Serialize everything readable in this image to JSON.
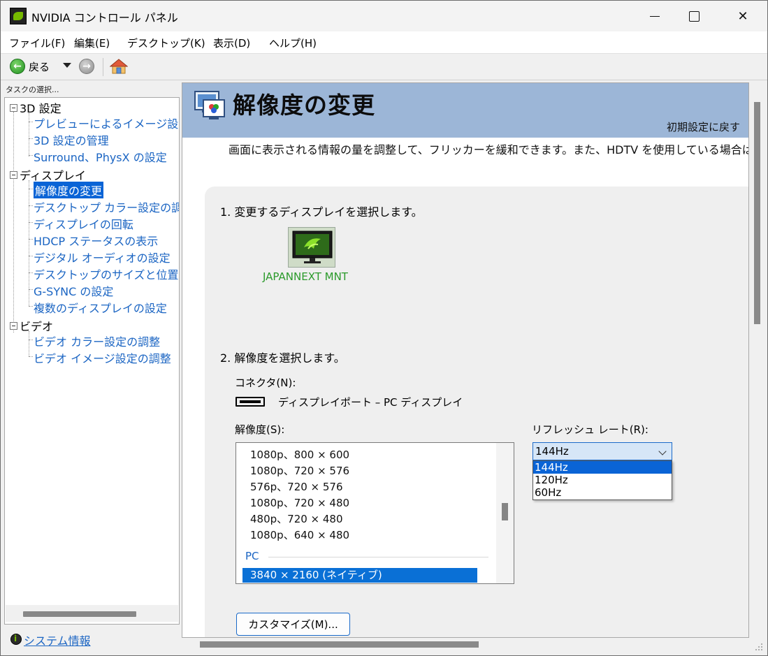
{
  "window": {
    "title": "NVIDIA コントロール パネル",
    "minimize": "",
    "maximize": "",
    "close": "✕"
  },
  "menu": [
    "ファイル(F)",
    "編集(E)",
    "デスクトップ(K)",
    "表示(D)",
    "ヘルプ(H)"
  ],
  "toolbar": {
    "back_label": "戻る"
  },
  "sidebar": {
    "caption": "タスクの選択...",
    "categories": [
      {
        "label": "3D 設定",
        "items": [
          "プレビューによるイメージ設定の",
          "3D 設定の管理",
          "Surround、PhysX の設定"
        ]
      },
      {
        "label": "ディスプレイ",
        "items": [
          "解像度の変更",
          "デスクトップ カラー設定の調整",
          "ディスプレイの回転",
          "HDCP ステータスの表示",
          "デジタル オーディオの設定",
          "デスクトップのサイズと位置の調",
          "G-SYNC の設定",
          "複数のディスプレイの設定"
        ]
      },
      {
        "label": "ビデオ",
        "items": [
          "ビデオ カラー設定の調整",
          "ビデオ イメージ設定の調整"
        ]
      }
    ],
    "selected": "解像度の変更",
    "system_info": "システム情報"
  },
  "page": {
    "title": "解像度の変更",
    "restore_defaults": "初期設定に戻す",
    "description": "画面に表示される情報の量を調整して、フリッカーを緩和できます。また、HDTV を使用している場合は高精",
    "step1": "1. 変更するディスプレイを選択します。",
    "display_name": "JAPANNEXT MNT",
    "step2": "2. 解像度を選択します。",
    "connector_label": "コネクタ(N):",
    "connector_value": "ディスプレイポート – PC ディスプレイ",
    "resolution_label": "解像度(S):",
    "refresh_label": "リフレッシュ レート(R):",
    "resolutions": [
      "1080p、800 × 600",
      "1080p、720 × 576",
      "576p、720 × 576",
      "1080p、720 × 480",
      "480p、720 × 480",
      "1080p、640 × 480"
    ],
    "pc_group": "PC",
    "selected_resolution": "3840 × 2160 (ネイティブ)",
    "refresh_selected": "144Hz",
    "refresh_options": [
      "144Hz",
      "120Hz",
      "60Hz"
    ],
    "customize_button": "カスタマイズ(M)..."
  },
  "colors": {
    "header_band": "#9cb6d7",
    "selection": "#0a64d6",
    "link": "#1b65c3",
    "nvidia_green": "#76b900"
  }
}
